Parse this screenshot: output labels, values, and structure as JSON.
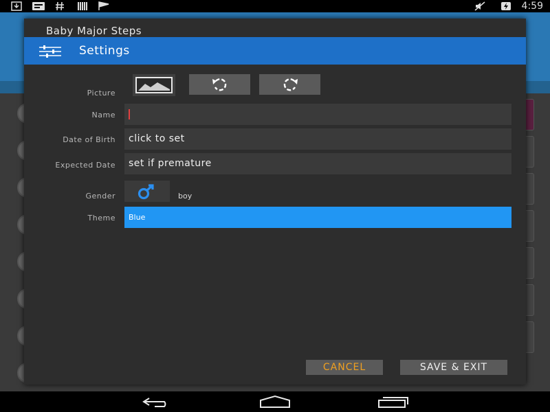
{
  "status_bar": {
    "time": "4:59",
    "left_icons": [
      "download-icon",
      "message-icon",
      "hash-icon",
      "barcode-icon",
      "signal-flag-icon"
    ],
    "right_icons": [
      "mute-icon",
      "battery-charging-icon"
    ]
  },
  "dialog": {
    "title": "Baby Major Steps",
    "header": {
      "title": "Settings",
      "icon": "settings-sliders-icon"
    },
    "fields": {
      "picture": {
        "label": "Picture"
      },
      "name": {
        "label": "Name",
        "value": ""
      },
      "date_of_birth": {
        "label": "Date of Birth",
        "value": "click to set"
      },
      "expected_date": {
        "label": "Expected Date",
        "value": "set if premature"
      },
      "gender": {
        "label": "Gender",
        "value": "boy",
        "icon": "male-symbol-icon"
      },
      "theme": {
        "label": "Theme",
        "value": "Blue"
      }
    },
    "buttons": {
      "cancel": "CANCEL",
      "save_exit": "SAVE & EXIT"
    }
  },
  "colors": {
    "accent_blue": "#1e70c8",
    "theme_blue": "#2196f3",
    "cancel_orange": "#f0a020",
    "cursor_red": "#e34040"
  },
  "nav_bar": {
    "icons": [
      "back-icon",
      "home-icon",
      "recents-icon"
    ]
  }
}
